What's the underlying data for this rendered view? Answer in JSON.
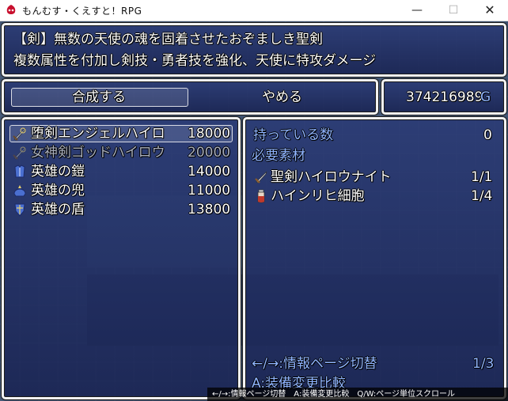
{
  "window": {
    "title": "もんむす・くえすと！RPG",
    "minimize_glyph": "—",
    "maximize_glyph": "☐",
    "close_glyph": "✕"
  },
  "help": {
    "line1": "【剣】無数の天使の魂を固着させたおぞましき聖剣",
    "line2": "複数属性を付加し剣技・勇者技を強化、天使に特攻ダメージ"
  },
  "commands": {
    "synthesize": "合成する",
    "cancel": "やめる"
  },
  "gold": {
    "amount": "374216989",
    "unit": "G"
  },
  "recipes": [
    {
      "name": "堕剣エンジェルハイロ",
      "price": "18000",
      "icon": "cursed-sword-icon",
      "enabled": true
    },
    {
      "name": "女神剣ゴッドハイロウ",
      "price": "20000",
      "icon": "cursed-sword-icon",
      "enabled": false
    },
    {
      "name": "英雄の鎧",
      "price": "14000",
      "icon": "armor-icon",
      "enabled": true
    },
    {
      "name": "英雄の兜",
      "price": "11000",
      "icon": "helmet-icon",
      "enabled": true
    },
    {
      "name": "英雄の盾",
      "price": "13800",
      "icon": "shield-icon",
      "enabled": true
    }
  ],
  "details": {
    "owned_label": "持っている数",
    "owned_count": "0",
    "materials_label": "必要素材",
    "materials": [
      {
        "name": "聖剣ハイロウナイト",
        "count": "1/1",
        "icon": "sword-icon"
      },
      {
        "name": "ハインリヒ細胞",
        "count": "1/4",
        "icon": "vial-icon"
      }
    ],
    "page_hint": "←/→:情報ページ切替",
    "page_number": "1/3",
    "compare_hint": "A:装備変更比較"
  },
  "bottom_help": "←/→:情報ページ切替　A:装備変更比較　Q/W:ページ単位スクロール",
  "colors": {
    "window_fill": "#23326e",
    "window_border": "#f2f2f2",
    "disabled_text": "#a9afbe",
    "system_text": "#8fb4ff",
    "gold_unit": "#8fb4ff"
  }
}
